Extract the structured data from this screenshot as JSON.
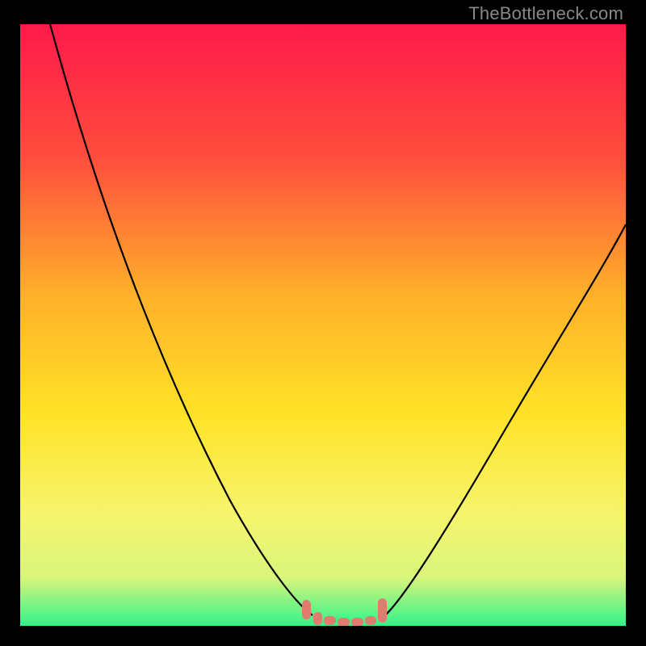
{
  "watermark": "TheBottleneck.com",
  "chart_data": {
    "type": "line",
    "title": "",
    "xlabel": "",
    "ylabel": "",
    "xlim": [
      0,
      100
    ],
    "ylim": [
      0,
      100
    ],
    "grid": false,
    "background_gradient": {
      "top": "#ff1a4b",
      "mid_upper": "#ff7a33",
      "mid": "#ffd21f",
      "mid_lower": "#f6f56e",
      "bottom": "#31f38a"
    },
    "series": [
      {
        "name": "left-curve",
        "color": "#000000",
        "x": [
          5,
          10,
          15,
          20,
          25,
          30,
          35,
          40,
          45,
          48
        ],
        "y": [
          100,
          90,
          79,
          67,
          55,
          43,
          31,
          19,
          8,
          2
        ]
      },
      {
        "name": "right-curve",
        "color": "#000000",
        "x": [
          60,
          63,
          67,
          72,
          78,
          85,
          92,
          100
        ],
        "y": [
          2,
          6,
          13,
          22,
          33,
          45,
          56,
          67
        ]
      },
      {
        "name": "bottom-markers",
        "color": "#e07b70",
        "type": "marker",
        "x": [
          47,
          49,
          51,
          53,
          55,
          57,
          59,
          60.5
        ],
        "y": [
          2.2,
          1.0,
          0.6,
          0.5,
          0.5,
          0.6,
          1.0,
          2.3
        ]
      }
    ]
  }
}
